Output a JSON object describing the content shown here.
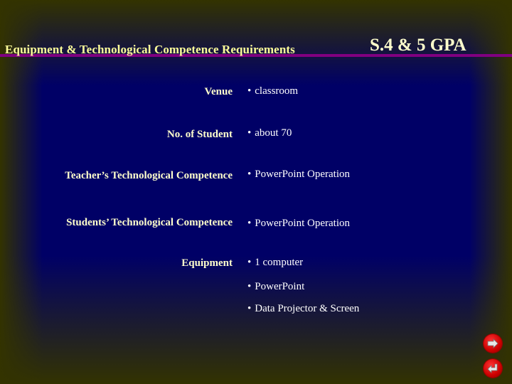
{
  "slide": {
    "title": "Equipment & Technological Competence Requirements",
    "subtitle": "S.4 & 5 GPA",
    "colors": {
      "background": "#000066",
      "frame": "#333300",
      "rule": "#800080",
      "label_text": "#ffffcc",
      "value_text": "#ffffff",
      "nav_button": "#cc0000"
    },
    "rows": [
      {
        "label": "Venue",
        "values": [
          "classroom"
        ]
      },
      {
        "label": "No. of Student",
        "values": [
          "about 70"
        ]
      },
      {
        "label": "Teacher’s Technological Competence",
        "values": [
          "PowerPoint Operation"
        ]
      },
      {
        "label": "Students’ Technological Competence",
        "values": [
          "PowerPoint Operation"
        ]
      },
      {
        "label": "Equipment",
        "values": [
          "1 computer",
          "PowerPoint",
          "Data Projector & Screen"
        ]
      }
    ],
    "bullet": "•"
  },
  "navigation": {
    "next_icon": "next-slide-icon",
    "return_icon": "return-icon"
  }
}
